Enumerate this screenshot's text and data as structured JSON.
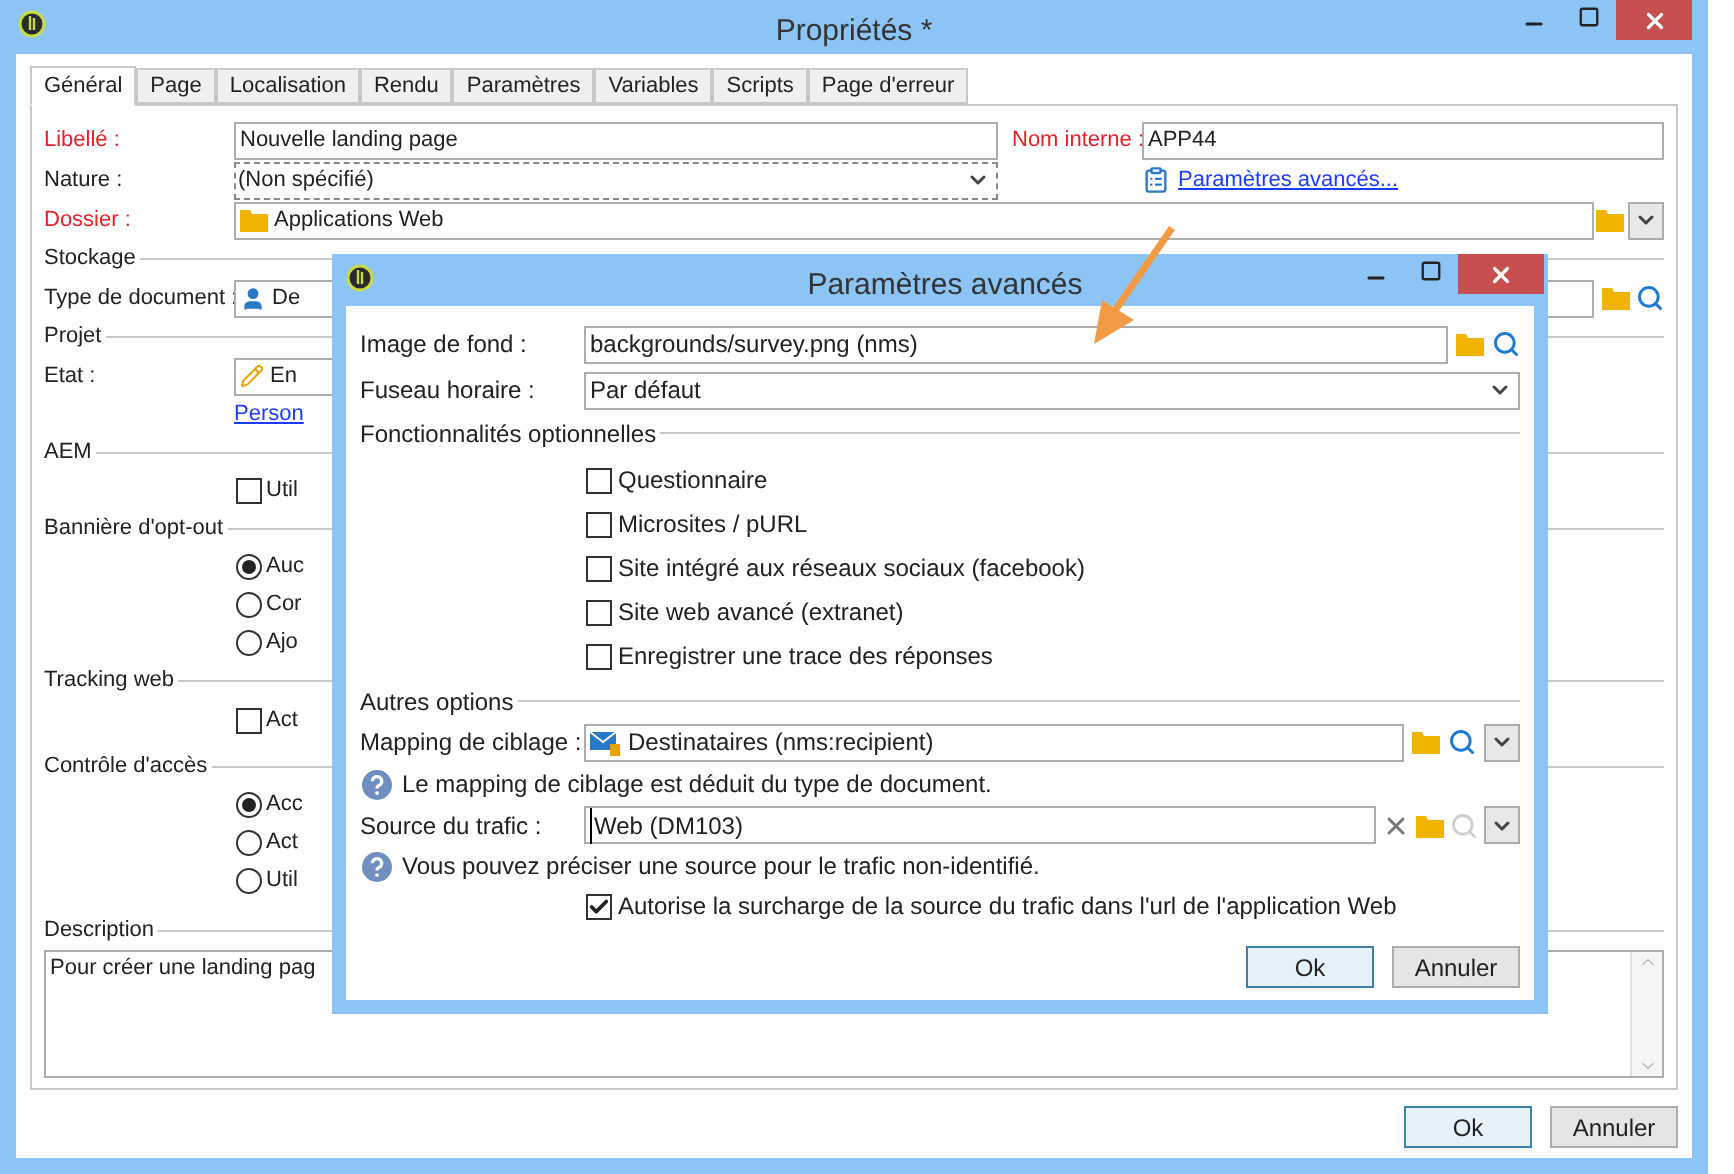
{
  "window": {
    "title": "Propriétés *"
  },
  "tabs": [
    {
      "label": "Général",
      "selected": true
    },
    {
      "label": "Page",
      "selected": false
    },
    {
      "label": "Localisation",
      "selected": false
    },
    {
      "label": "Rendu",
      "selected": false
    },
    {
      "label": "Paramètres",
      "selected": false
    },
    {
      "label": "Variables",
      "selected": false
    },
    {
      "label": "Scripts",
      "selected": false
    },
    {
      "label": "Page d'erreur",
      "selected": false
    }
  ],
  "libelle": {
    "label": "Libellé :",
    "value": "Nouvelle landing page",
    "required": true
  },
  "nom_interne": {
    "label": "Nom interne :",
    "value": "APP44",
    "required": true
  },
  "nature": {
    "label": "Nature :",
    "value": "(Non spécifié)",
    "required": false
  },
  "advanced_link": "Paramètres avancés...",
  "dossier": {
    "label": "Dossier :",
    "value": "Applications Web",
    "required": true
  },
  "stockage": {
    "title": "Stockage",
    "type_document": {
      "label": "Type de document :",
      "value": "De",
      "required": false
    }
  },
  "projet": {
    "title": "Projet",
    "etat": {
      "label": "Etat :",
      "value": "En",
      "required": false
    },
    "link": "Person"
  },
  "aem": {
    "title": "AEM",
    "checkbox": {
      "label": "Util",
      "checked": false
    }
  },
  "banniere": {
    "title": "Bannière d'opt-out",
    "options": [
      {
        "label": "Auc",
        "selected": true
      },
      {
        "label": "Cor",
        "selected": false
      },
      {
        "label": "Ajo",
        "selected": false
      }
    ]
  },
  "tracking": {
    "title": "Tracking web",
    "checkbox": {
      "label": "Act",
      "checked": false
    }
  },
  "controle": {
    "title": "Contrôle d'accès",
    "options": [
      {
        "label": "Acc",
        "selected": true
      },
      {
        "label": "Act",
        "selected": false
      },
      {
        "label": "Util",
        "selected": false
      }
    ]
  },
  "description": {
    "title": "Description",
    "value": "Pour créer une landing pag"
  },
  "buttons": [
    {
      "label": "Ok",
      "default": true
    },
    {
      "label": "Annuler",
      "default": false
    }
  ],
  "dialog": {
    "title": "Paramètres avancés",
    "image_fond": {
      "label": "Image de fond :",
      "value": "backgrounds/survey.png (nms)"
    },
    "fuseau": {
      "label": "Fuseau horaire :",
      "value": "Par défaut"
    },
    "fonctionnalites": {
      "title": "Fonctionnalités optionnelles",
      "options": [
        {
          "label": "Questionnaire",
          "checked": false
        },
        {
          "label": "Microsites / pURL",
          "checked": false
        },
        {
          "label": "Site intégré aux réseaux sociaux (facebook)",
          "checked": false
        },
        {
          "label": "Site web avancé (extranet)",
          "checked": false
        },
        {
          "label": "Enregistrer une trace des réponses",
          "checked": false
        }
      ]
    },
    "autres": {
      "title": "Autres options",
      "mapping": {
        "label": "Mapping de ciblage :",
        "value": "Destinataires (nms:recipient)"
      },
      "mapping_hint": "Le mapping de ciblage est déduit du type de document.",
      "source": {
        "label": "Source du trafic :",
        "value": "Web (DM103)"
      },
      "source_hint": "Vous pouvez préciser une source pour le trafic non-identifié.",
      "override": {
        "label": "Autorise la surcharge de la source du trafic dans l'url de l'application Web",
        "checked": true
      }
    },
    "buttons": [
      {
        "label": "Ok",
        "default": true
      },
      {
        "label": "Annuler",
        "default": false
      }
    ]
  }
}
